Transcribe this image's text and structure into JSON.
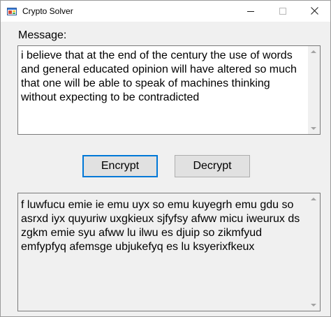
{
  "window": {
    "title": "Crypto Solver",
    "icon": "windows-forms-app-icon",
    "controls": [
      "minimize-icon",
      "maximize-icon",
      "close-icon"
    ]
  },
  "message": {
    "label": "Message:",
    "value": "i believe that at the end of the century the use of words and general educated opinion will have altered so much that one will be able to speak of machines thinking without expecting to be contradicted"
  },
  "buttons": {
    "encrypt": "Encrypt",
    "decrypt": "Decrypt"
  },
  "output": {
    "value": "f luwfucu emie ie emu uyx so emu kuyegrh emu gdu so asrxd iyx quyuriw uxgkieux sjfyfsy afww micu iweurux ds zgkm emie syu afww lu ilwu es djuip so zikmfyud emfypfyq afemsge ubjukefyq es lu ksyerixfkeux"
  },
  "colors": {
    "focus_border": "#0078d7",
    "window_background": "#f0f0f0",
    "button_background": "#e1e1e1"
  }
}
